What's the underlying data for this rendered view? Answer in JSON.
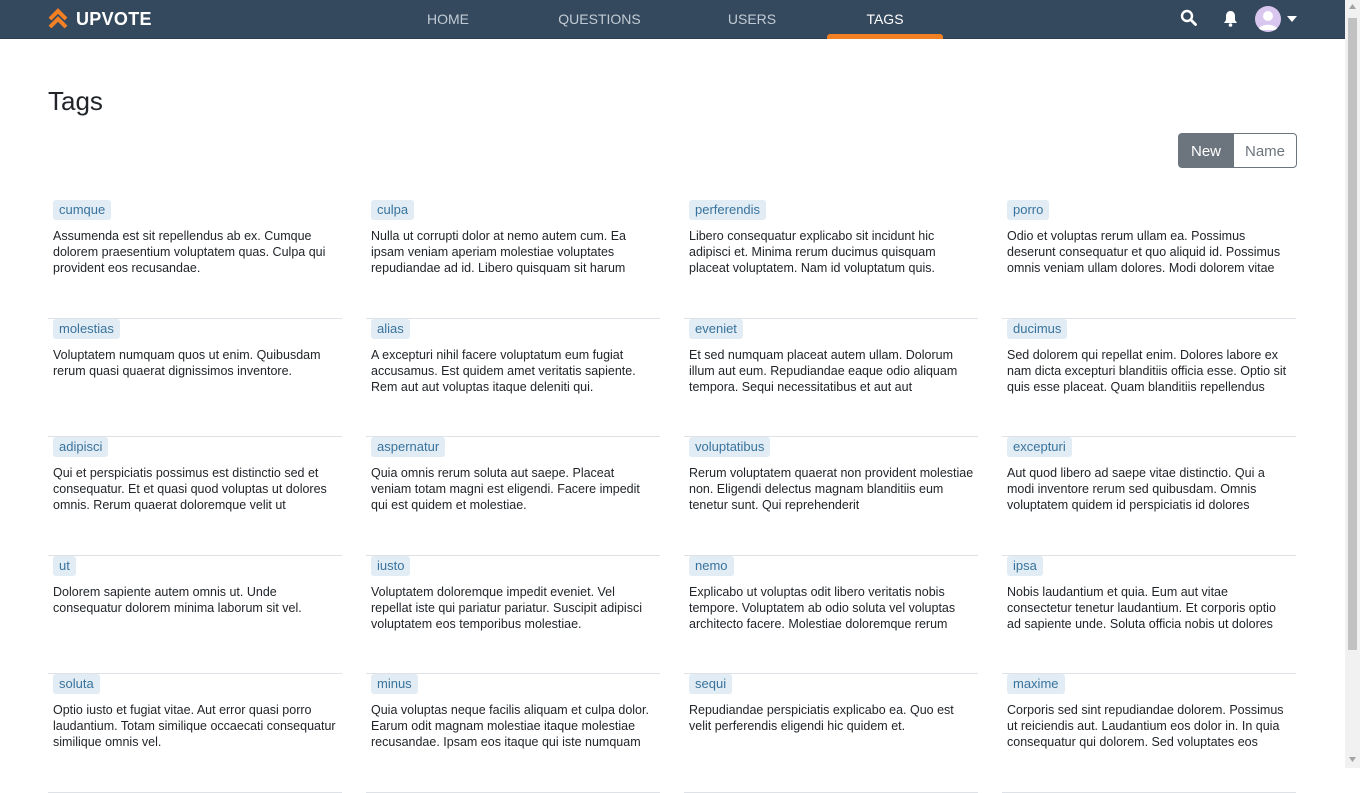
{
  "navbar": {
    "brand": "UPVOTE",
    "items": [
      {
        "label": "HOME"
      },
      {
        "label": "QUESTIONS"
      },
      {
        "label": "USERS"
      },
      {
        "label": "TAGS"
      }
    ],
    "active_item": "TAGS",
    "icons": [
      "search-icon",
      "bell-icon",
      "avatar",
      "caret-down-icon"
    ]
  },
  "page": {
    "title": "Tags"
  },
  "sort": {
    "new_label": "New",
    "name_label": "Name",
    "selected": "New"
  },
  "tags": [
    {
      "name": "cumque",
      "description": "Assumenda est sit repellendus ab ex. Cumque dolorem praesentium voluptatem quas. Culpa qui provident eos recusandae."
    },
    {
      "name": "culpa",
      "description": "Nulla ut corrupti dolor at nemo autem cum. Ea ipsam veniam aperiam molestiae voluptates repudiandae ad id. Libero quisquam sit harum"
    },
    {
      "name": "perferendis",
      "description": "Libero consequatur explicabo sit incidunt hic adipisci et. Minima rerum ducimus quisquam placeat voluptatem. Nam id voluptatum quis."
    },
    {
      "name": "porro",
      "description": "Odio et voluptas rerum ullam ea. Possimus deserunt consequatur et quo aliquid id. Possimus omnis veniam ullam dolores. Modi dolorem vitae"
    },
    {
      "name": "molestias",
      "description": "Voluptatem numquam quos ut enim. Quibusdam rerum quasi quaerat dignissimos inventore."
    },
    {
      "name": "alias",
      "description": "A excepturi nihil facere voluptatum eum fugiat accusamus. Est quidem amet veritatis sapiente. Rem aut aut voluptas itaque deleniti qui."
    },
    {
      "name": "eveniet",
      "description": "Et sed numquam placeat autem ullam. Dolorum illum aut eum. Repudiandae eaque odio aliquam tempora. Sequi necessitatibus et aut aut"
    },
    {
      "name": "ducimus",
      "description": "Sed dolorem qui repellat enim. Dolores labore ex nam dicta excepturi blanditiis officia esse. Optio sit quis esse placeat. Quam blanditiis repellendus"
    },
    {
      "name": "adipisci",
      "description": "Qui et perspiciatis possimus est distinctio sed et consequatur. Et et quasi quod voluptas ut dolores omnis. Rerum quaerat doloremque velit ut"
    },
    {
      "name": "aspernatur",
      "description": "Quia omnis rerum soluta aut saepe. Placeat veniam totam magni est eligendi. Facere impedit qui est quidem et molestiae."
    },
    {
      "name": "voluptatibus",
      "description": "Rerum voluptatem quaerat non provident molestiae non. Eligendi delectus magnam blanditiis eum tenetur sunt. Qui reprehenderit"
    },
    {
      "name": "excepturi",
      "description": "Aut quod libero ad saepe vitae distinctio. Qui a modi inventore rerum sed quibusdam. Omnis voluptatem quidem id perspiciatis id dolores"
    },
    {
      "name": "ut",
      "description": "Dolorem sapiente autem omnis ut. Unde consequatur dolorem minima laborum sit vel."
    },
    {
      "name": "iusto",
      "description": "Voluptatem doloremque impedit eveniet. Vel repellat iste qui pariatur pariatur. Suscipit adipisci voluptatem eos temporibus molestiae."
    },
    {
      "name": "nemo",
      "description": "Explicabo ut voluptas odit libero veritatis nobis tempore. Voluptatem ab odio soluta vel voluptas architecto facere. Molestiae doloremque rerum"
    },
    {
      "name": "ipsa",
      "description": "Nobis laudantium et quia. Eum aut vitae consectetur tenetur laudantium. Et corporis optio ad sapiente unde. Soluta officia nobis ut dolores"
    },
    {
      "name": "soluta",
      "description": "Optio iusto et fugiat vitae. Aut error quasi porro laudantium. Totam similique occaecati consequatur similique omnis vel."
    },
    {
      "name": "minus",
      "description": "Quia voluptas neque facilis aliquam et culpa dolor. Earum odit magnam molestiae itaque molestiae recusandae. Ipsam eos itaque qui iste numquam"
    },
    {
      "name": "sequi",
      "description": "Repudiandae perspiciatis explicabo ea. Quo est velit perferendis eligendi hic quidem et."
    },
    {
      "name": "maxime",
      "description": "Corporis sed sint repudiandae dolorem. Possimus ut reiciendis aut. Laudantium eos dolor in. In quia consequatur qui dolorem. Sed voluptates eos"
    }
  ],
  "colors": {
    "navbar_bg": "#34495e",
    "accent": "#f48024",
    "tag_bg": "#e1ecf4",
    "tag_text": "#39739d"
  }
}
